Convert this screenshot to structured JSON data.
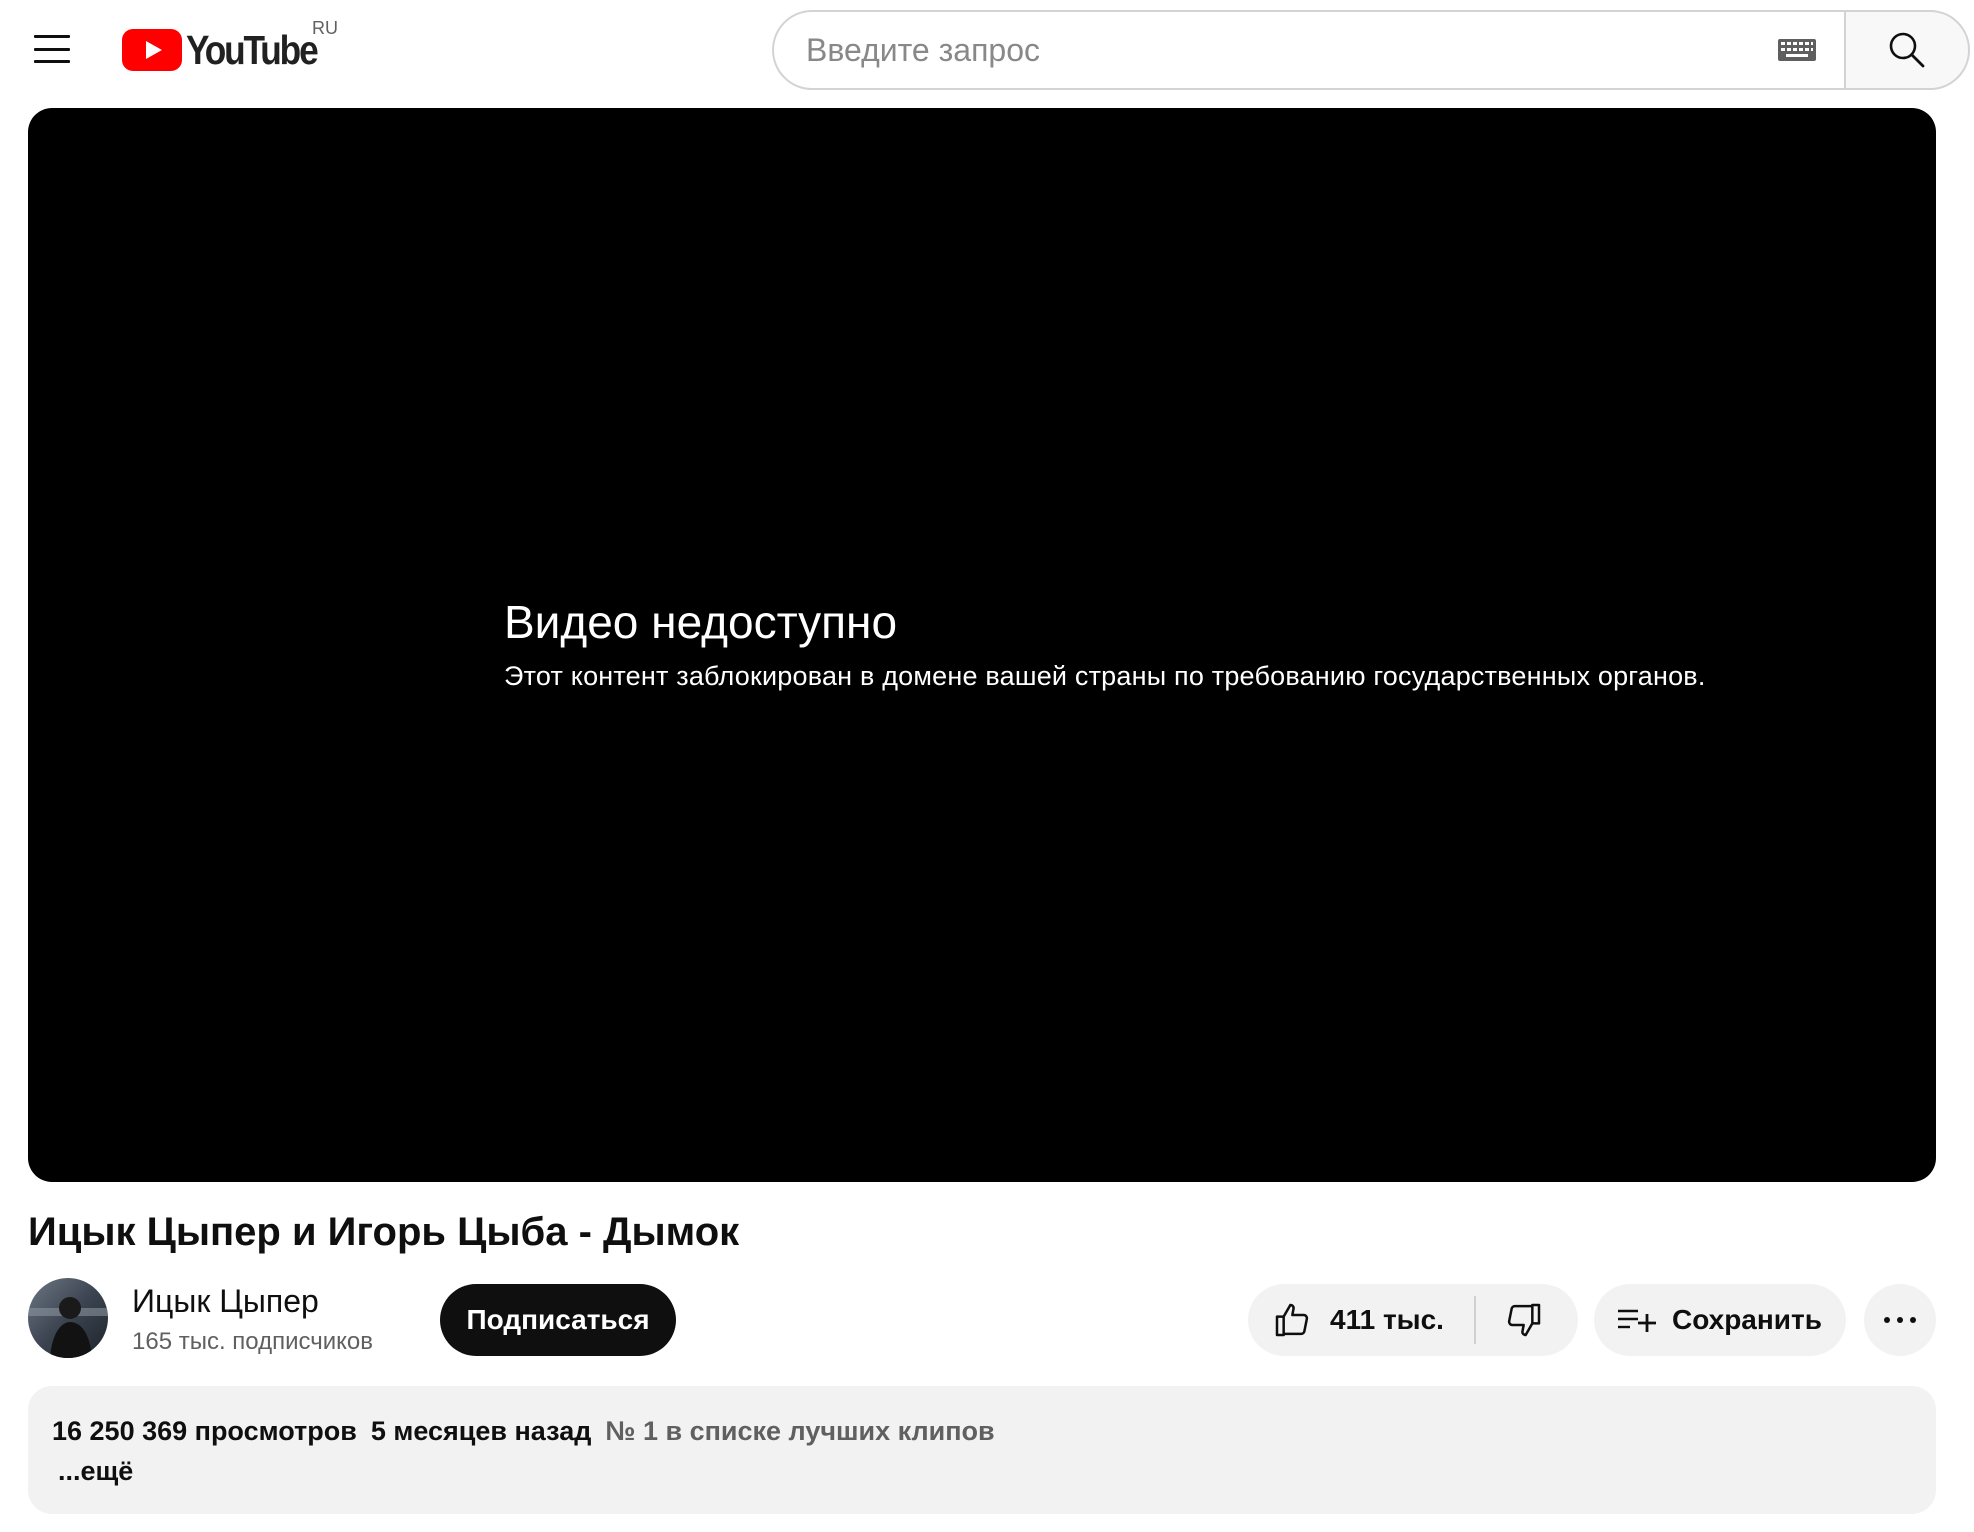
{
  "header": {
    "logo_text": "YouTube",
    "country_code": "RU",
    "search_placeholder": "Введите запрос",
    "search_value": ""
  },
  "player": {
    "error_title": "Видео недоступно",
    "error_message": "Этот контент заблокирован в домене вашей страны по требованию государственных органов."
  },
  "video": {
    "title": "Ицык Цыпер и Игорь Цыба - Дымок"
  },
  "owner": {
    "channel_name": "Ицык Цыпер",
    "subscribers": "165 тыс. подписчиков",
    "subscribe_label": "Подписаться"
  },
  "actions": {
    "like_count": "411 тыс.",
    "save_label": "Сохранить"
  },
  "description": {
    "views": "16 250 369 просмотров",
    "date": "5 месяцев назад",
    "rank": "№ 1 в списке лучших клипов",
    "more_label": "...ещё"
  },
  "colors": {
    "brand_red": "#ff0000",
    "player_bg": "#000000",
    "chip_bg": "#f2f2f2",
    "subscribe_bg": "#0f0f0f"
  }
}
